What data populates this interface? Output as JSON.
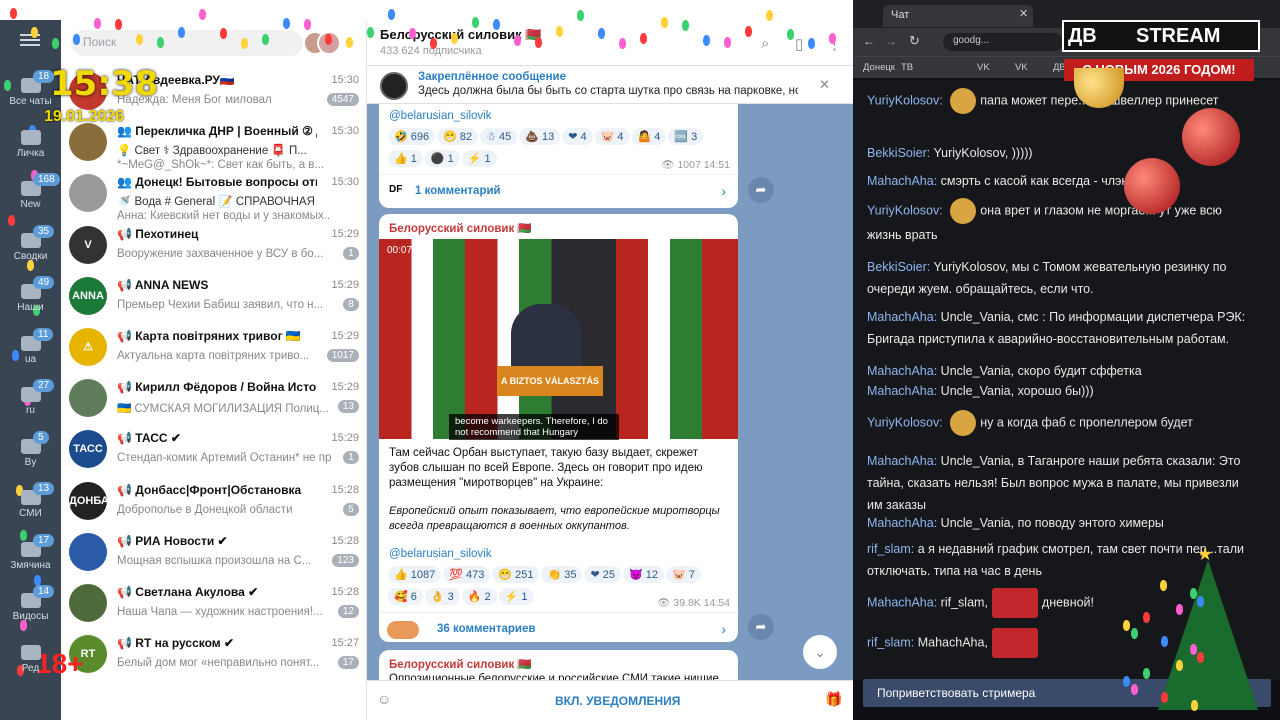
{
  "left_overlay": {
    "clock": "15:38",
    "date": "19.01.2026",
    "age": "18+"
  },
  "folders": [
    {
      "label": "Все чаты",
      "badge": "18"
    },
    {
      "label": "Личка",
      "badge": ""
    },
    {
      "label": "New",
      "badge": "168"
    },
    {
      "label": "Сводки",
      "badge": "35"
    },
    {
      "label": "Наши",
      "badge": "49"
    },
    {
      "label": "ua",
      "badge": "11"
    },
    {
      "label": "ru",
      "badge": "27"
    },
    {
      "label": "By",
      "badge": "5"
    },
    {
      "label": "СМИ",
      "badge": "13"
    },
    {
      "label": "Змячина",
      "badge": "17"
    },
    {
      "label": "Видосы",
      "badge": "14"
    },
    {
      "label": "Ред",
      "badge": ""
    }
  ],
  "search_placeholder": "Поиск",
  "chats": [
    {
      "name": "ЧАТ Авдеевка.РУ🇷🇺",
      "time": "15:30",
      "preview": "Надежда: Меня Бог миловал",
      "badge": "4547",
      "avatar": ""
    },
    {
      "name": "👥 Перекличка ДНР | Военный ② До...",
      "time": "15:30",
      "tags": "💡 Свет   ⚕ Здравоохранение   📮 П...",
      "preview": "*~MeG@_ShOk~*: Свет как быть, а в...",
      "badge": "16",
      "avatar": ""
    },
    {
      "name": "👥 Донецк! Бытовые вопросы ответы:",
      "time": "15:30",
      "tags": "🚿 Вода   # General   📝 СПРАВОЧНАЯ",
      "preview": "Анна: Киевский нет воды и у знакомых...",
      "badge": "14",
      "avatar": ""
    },
    {
      "name": "📢 Пехотинец",
      "time": "15:29",
      "preview": "Вооружение захваченное у ВСУ в бо...",
      "badge": "1",
      "avatar": "V"
    },
    {
      "name": "📢 ANNA NEWS",
      "time": "15:29",
      "preview": "Премьер Чехии Бабиш заявил, что н...",
      "badge": "8",
      "avatar": "ANNA"
    },
    {
      "name": "📢 Карта повітряних тривог 🇺🇦",
      "time": "15:29",
      "preview": "Актуальна карта повітряних триво...",
      "badge": "1017",
      "avatar": "⚠"
    },
    {
      "name": "📢 Кирилл Фёдоров / Война История ...",
      "time": "15:29",
      "preview": "🇺🇦 СУМСКАЯ МОГИЛИЗАЦИЯ  Полиц...",
      "badge": "13",
      "avatar": ""
    },
    {
      "name": "📢 ТАСС ✔",
      "time": "15:29",
      "preview": "Стендап-комик Артемий Останин* не пр...",
      "badge": "1",
      "avatar": "ТАСС"
    },
    {
      "name": "📢 Донбасс|Фронт|Обстановка",
      "time": "15:28",
      "preview": "Доброполье в Донецкой области",
      "badge": "5",
      "avatar": "ДОНБАСС"
    },
    {
      "name": "📢 РИА Новости ✔",
      "time": "15:28",
      "preview": "Мощная вспышка произошла на С...",
      "badge": "123",
      "avatar": ""
    },
    {
      "name": "📢 Светлана Акулова ✔",
      "time": "15:28",
      "preview": "Наша Чапа — художник настроения!...",
      "badge": "12",
      "avatar": ""
    },
    {
      "name": "📢 RT на русском ✔",
      "time": "15:27",
      "preview": "Белый дом мог «неправильно понят...",
      "badge": "17",
      "avatar": "RT"
    }
  ],
  "channel": {
    "title": "Белорусский силовик 🇧🇾",
    "subscribers": "433 624 подписчика",
    "pinned_title": "Закреплённое сообщение",
    "pinned_text": "Здесь должна была бы быть со старта шутка про связь на парковке, но ...",
    "post1": {
      "link": "@belarusian_silovik",
      "reactions_row1": [
        "🤣 696",
        "😁 82",
        "☃ 45",
        "💩 13",
        "❤ 4",
        "🐷 4",
        "🤷 4",
        "🆒 3"
      ],
      "reactions_row2": [
        "👍 1",
        "⚫ 1",
        "⚡ 1"
      ],
      "views": "👁 1007  14:51",
      "comments": "1 комментарий"
    },
    "post2": {
      "author": "Белорусский силовик 🇧🇾",
      "video_time": "00:07",
      "podium": "A BIZTOS VÁLASZTÁS",
      "subtitle": "become warkeepers.  Therefore, I do not recommend that Hungary",
      "text": "Там сейчас Орбан выступает, такую базу выдает, скрежет зубов слышан по всей Европе. Здесь он говорит про идею размещения \"миротворцев\" на Украине:",
      "quote": "Европейский опыт показывает, что европейские миротворцы всегда превращаются в военных оккупантов.",
      "link": "@belarusian_silovik",
      "reactions_row1": [
        "👍 1087",
        "💯 473",
        "😁 251",
        "👏 35",
        "❤ 25",
        "😈 12",
        "🐷 7"
      ],
      "reactions_row2": [
        "🥰 6",
        "👌 3",
        "🔥 2",
        "⚡ 1"
      ],
      "views": "👁 39.8K  14:54",
      "comments": "36 комментариев"
    },
    "post3": {
      "author": "Белорусский силовик 🇧🇾",
      "text": "Оппозиционные белорусские и российские СМИ такие нищие"
    },
    "notify": "ВКЛ. УВЕДОМЛЕНИЯ"
  },
  "browser": {
    "tab": "Чат",
    "url": "goodg...",
    "bookmarks": [
      "Донецк",
      "ТВ",
      "",
      "VK",
      "VK",
      "ДВ",
      "ЗД"
    ]
  },
  "stream": {
    "logo_left": "ДВ",
    "logo_right": "STREAM",
    "new_year": "С НОВЫМ 2026 ГОДОМ!",
    "messages": [
      {
        "user": "YuriyKolosov:",
        "emote": true,
        "text": "папа может пере... т... швеллер принесет"
      },
      {
        "user": "BekkiSoier:",
        "text": "YuriyKolosov, )))))"
      },
      {
        "user": "MahachAha:",
        "text": "смэрть с касой как всегда - члэн"
      },
      {
        "user": "YuriyKolosov:",
        "emote": true,
        "text": "она врет и глазом не моргае... ут уже всю жизнь врать"
      },
      {
        "user": "BekkiSoier:",
        "text": "YuriyKolosov, мы с Томом жевательную резинку по очереди жуем. обращайтесь, если что."
      },
      {
        "user": "MahachAha:",
        "text": "Uncle_Vania, смс : По информации диспетчера РЭК: Бригада приступила к аварийно-восстановительным работам."
      },
      {
        "user": "MahachAha:",
        "text": "Uncle_Vania, скоро будит сффетка"
      },
      {
        "user": "MahachAha:",
        "text": "Uncle_Vania, хорошо бы)))"
      },
      {
        "user": "YuriyKolosov:",
        "emote": true,
        "text": "ну а когда фаб с пропеллером будет"
      },
      {
        "user": "MahachAha:",
        "text": "Uncle_Vania, в Таганроге наши ребята сказали: Это тайна, сказать нельзя! Был вопрос мужа в палате, мы привезли им заказы"
      },
      {
        "user": "MahachAha:",
        "text": "Uncle_Vania, по поводу энтого химеры"
      },
      {
        "user": "rif_slam:",
        "text": "а я недавний график смотрел, там свет почти пер...тали отключать. типа на час в день"
      },
      {
        "user": "MahachAha:",
        "text": "rif_slam,",
        "emote2": true,
        "after": "дневной!"
      },
      {
        "user": "rif_slam:",
        "text": "MahachAha,",
        "emote2": true,
        "after": ""
      }
    ],
    "greet": "Поприветствовать стримера"
  }
}
